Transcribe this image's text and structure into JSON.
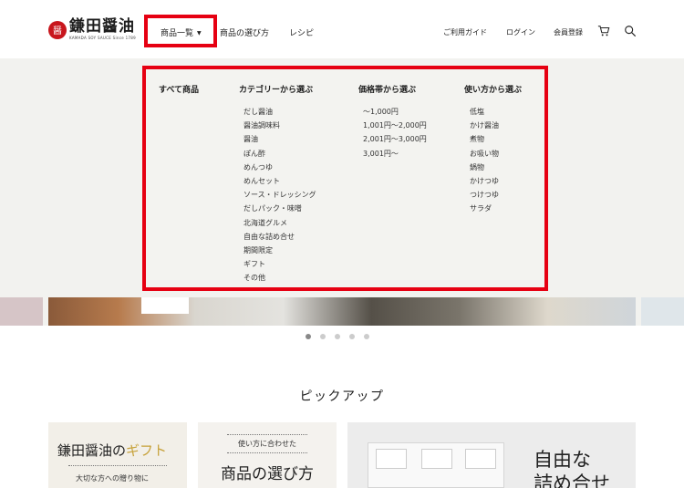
{
  "brand": {
    "mark": "醤",
    "name": "鎌田醤油",
    "sub": "KAMADA SOY SAUCE Since 1789"
  },
  "nav": {
    "products": "商品一覧",
    "select": "商品の選び方",
    "recipe": "レシピ",
    "guide": "ご利用ガイド",
    "login": "ログイン",
    "register": "会員登録"
  },
  "icons": {
    "cart": "cart-icon",
    "search": "search-icon",
    "caret": "chevron-down-icon"
  },
  "menu": {
    "all": "すべて商品",
    "category": {
      "heading": "カテゴリーから選ぶ",
      "items": [
        "だし醤油",
        "醤油調味料",
        "醤油",
        "ぽん酢",
        "めんつゆ",
        "めんセット",
        "ソース・ドレッシング",
        "だしパック・味噌",
        "北海道グルメ",
        "自由な詰め合せ",
        "期間限定",
        "ギフト",
        "その他"
      ]
    },
    "price": {
      "heading": "価格帯から選ぶ",
      "items": [
        "〜1,000円",
        "1,001円〜2,000円",
        "2,001円〜3,000円",
        "3,001円〜"
      ]
    },
    "usage": {
      "heading": "使い方から選ぶ",
      "items": [
        "低塩",
        "かけ醤油",
        "煮物",
        "お吸い物",
        "鍋物",
        "かけつゆ",
        "つけつゆ",
        "サラダ"
      ]
    }
  },
  "pickup": {
    "title": "ピックアップ",
    "gift_title_a": "鎌田醤油の",
    "gift_title_b": "ギフト",
    "gift_sub": "大切な方への贈り物に",
    "select_top": "使い方に合わせた",
    "select_title": "商品の選び方",
    "free_line1": "自由な",
    "free_line2": "詰め合せ"
  },
  "colors": {
    "accent": "#e60012",
    "gold": "#c7a23b",
    "brand_red": "#c8161d"
  }
}
